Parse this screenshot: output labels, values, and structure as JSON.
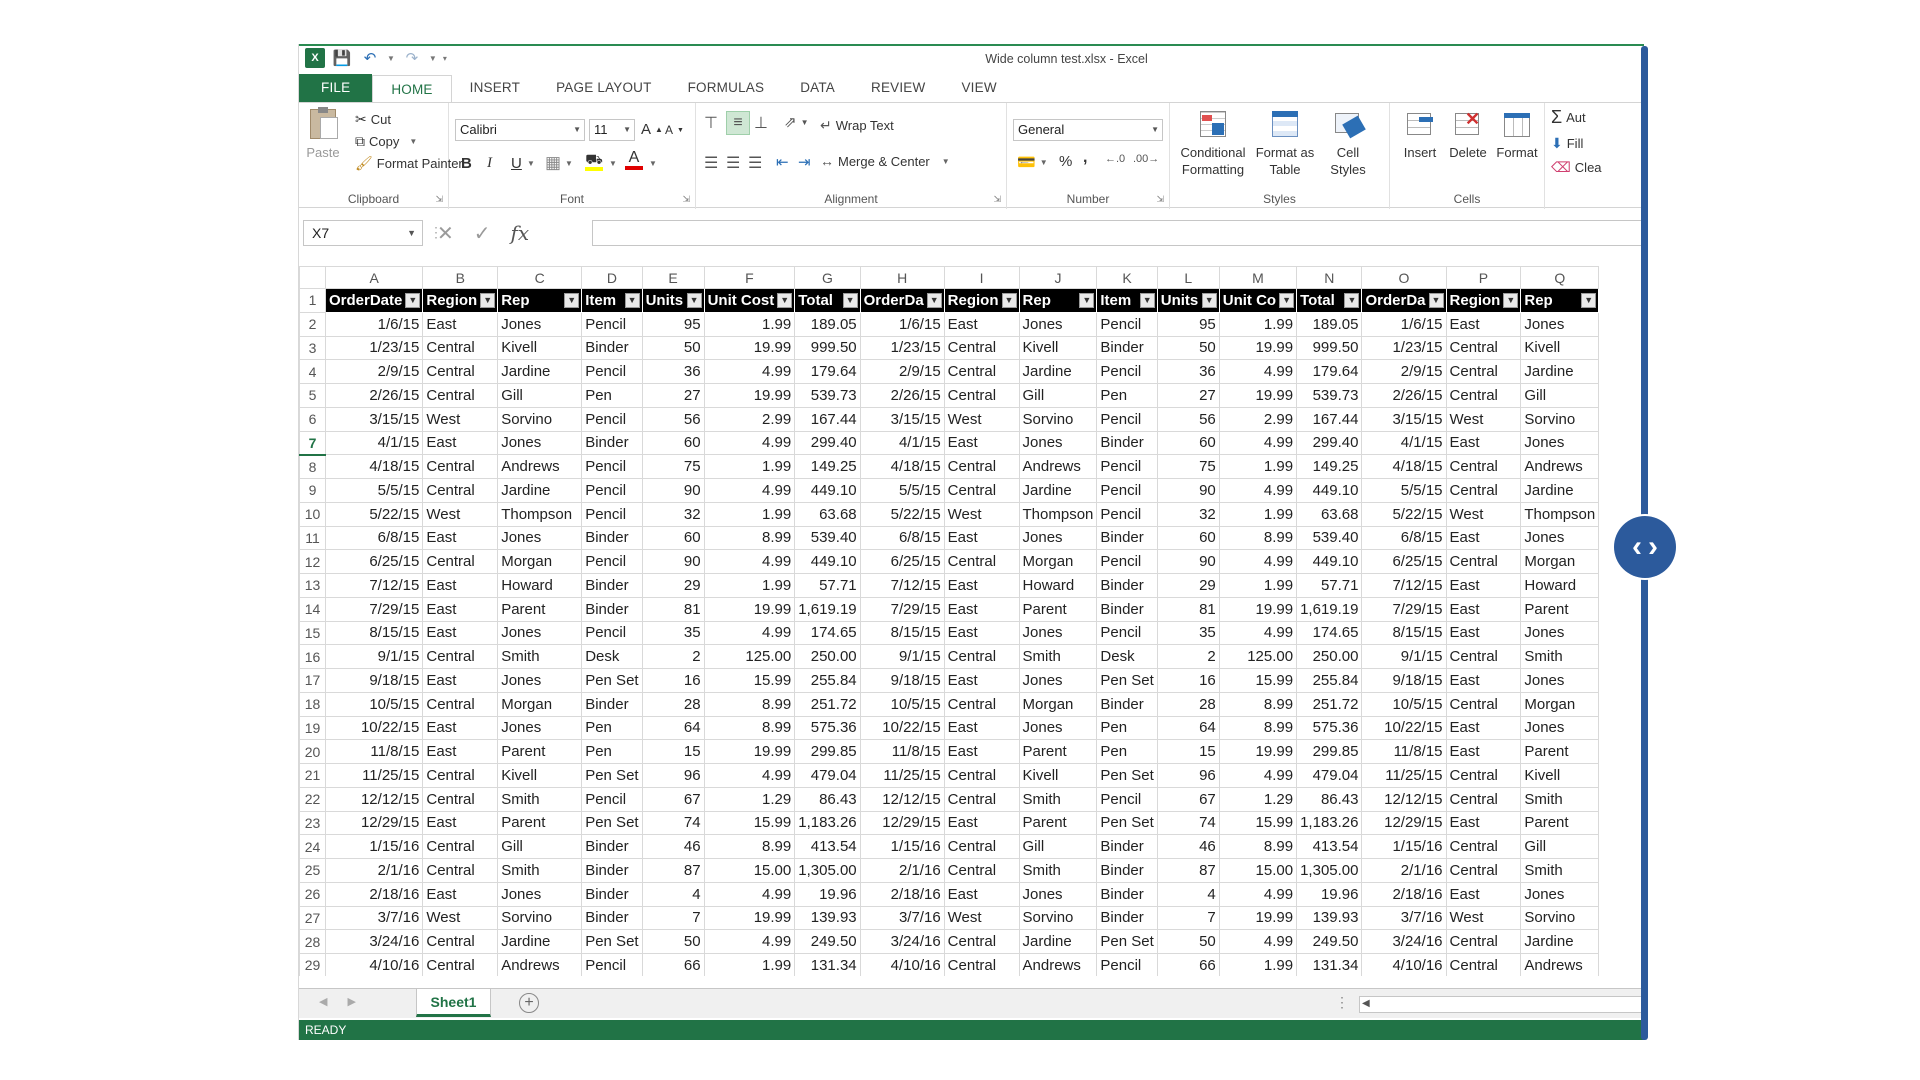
{
  "window": {
    "title": "Wide column test.xlsx - Excel"
  },
  "ribbon_tabs": [
    {
      "label": "FILE"
    },
    {
      "label": "HOME"
    },
    {
      "label": "INSERT"
    },
    {
      "label": "PAGE LAYOUT"
    },
    {
      "label": "FORMULAS"
    },
    {
      "label": "DATA"
    },
    {
      "label": "REVIEW"
    },
    {
      "label": "VIEW"
    }
  ],
  "clipboard": {
    "paste": "Paste",
    "cut": "Cut",
    "copy": "Copy",
    "format_painter": "Format Painter",
    "label": "Clipboard"
  },
  "font": {
    "name": "Calibri",
    "size": "11",
    "bold": "B",
    "italic": "I",
    "underline": "U",
    "label": "Font"
  },
  "alignment": {
    "wrap_text": "Wrap Text",
    "merge_center": "Merge & Center",
    "label": "Alignment"
  },
  "number": {
    "format": "General",
    "percent": "%",
    "comma": ",",
    "label": "Number"
  },
  "styles": {
    "conditional_1": "Conditional",
    "conditional_2": "Formatting",
    "format_table_1": "Format as",
    "format_table_2": "Table",
    "cell_styles_1": "Cell",
    "cell_styles_2": "Styles",
    "label": "Styles"
  },
  "cells": {
    "insert": "Insert",
    "delete": "Delete",
    "format": "Format",
    "label": "Cells"
  },
  "editing": {
    "autosum": "Aut",
    "fill": "Fill",
    "clear": "Clea"
  },
  "formula_bar": {
    "name_box": "X7",
    "fx": "fx",
    "value": ""
  },
  "grid": {
    "columns": [
      "A",
      "B",
      "C",
      "D",
      "E",
      "F",
      "G",
      "H",
      "I",
      "J",
      "K",
      "L",
      "M",
      "N",
      "O",
      "P",
      "Q"
    ],
    "selected_row": 7,
    "header_labels": [
      "OrderDate",
      "Region",
      "Rep",
      "Item",
      "Units",
      "Unit Cost",
      "Total",
      "OrderDa",
      "Region",
      "Rep",
      "Item",
      "Units",
      "Unit Co",
      "Total",
      "OrderDa",
      "Region",
      "Rep"
    ],
    "rows": [
      [
        "1/6/15",
        "East",
        "Jones",
        "Pencil",
        "95",
        "1.99",
        "189.05"
      ],
      [
        "1/23/15",
        "Central",
        "Kivell",
        "Binder",
        "50",
        "19.99",
        "999.50"
      ],
      [
        "2/9/15",
        "Central",
        "Jardine",
        "Pencil",
        "36",
        "4.99",
        "179.64"
      ],
      [
        "2/26/15",
        "Central",
        "Gill",
        "Pen",
        "27",
        "19.99",
        "539.73"
      ],
      [
        "3/15/15",
        "West",
        "Sorvino",
        "Pencil",
        "56",
        "2.99",
        "167.44"
      ],
      [
        "4/1/15",
        "East",
        "Jones",
        "Binder",
        "60",
        "4.99",
        "299.40"
      ],
      [
        "4/18/15",
        "Central",
        "Andrews",
        "Pencil",
        "75",
        "1.99",
        "149.25"
      ],
      [
        "5/5/15",
        "Central",
        "Jardine",
        "Pencil",
        "90",
        "4.99",
        "449.10"
      ],
      [
        "5/22/15",
        "West",
        "Thompson",
        "Pencil",
        "32",
        "1.99",
        "63.68"
      ],
      [
        "6/8/15",
        "East",
        "Jones",
        "Binder",
        "60",
        "8.99",
        "539.40"
      ],
      [
        "6/25/15",
        "Central",
        "Morgan",
        "Pencil",
        "90",
        "4.99",
        "449.10"
      ],
      [
        "7/12/15",
        "East",
        "Howard",
        "Binder",
        "29",
        "1.99",
        "57.71"
      ],
      [
        "7/29/15",
        "East",
        "Parent",
        "Binder",
        "81",
        "19.99",
        "1,619.19"
      ],
      [
        "8/15/15",
        "East",
        "Jones",
        "Pencil",
        "35",
        "4.99",
        "174.65"
      ],
      [
        "9/1/15",
        "Central",
        "Smith",
        "Desk",
        "2",
        "125.00",
        "250.00"
      ],
      [
        "9/18/15",
        "East",
        "Jones",
        "Pen Set",
        "16",
        "15.99",
        "255.84"
      ],
      [
        "10/5/15",
        "Central",
        "Morgan",
        "Binder",
        "28",
        "8.99",
        "251.72"
      ],
      [
        "10/22/15",
        "East",
        "Jones",
        "Pen",
        "64",
        "8.99",
        "575.36"
      ],
      [
        "11/8/15",
        "East",
        "Parent",
        "Pen",
        "15",
        "19.99",
        "299.85"
      ],
      [
        "11/25/15",
        "Central",
        "Kivell",
        "Pen Set",
        "96",
        "4.99",
        "479.04"
      ],
      [
        "12/12/15",
        "Central",
        "Smith",
        "Pencil",
        "67",
        "1.29",
        "86.43"
      ],
      [
        "12/29/15",
        "East",
        "Parent",
        "Pen Set",
        "74",
        "15.99",
        "1,183.26"
      ],
      [
        "1/15/16",
        "Central",
        "Gill",
        "Binder",
        "46",
        "8.99",
        "413.54"
      ],
      [
        "2/1/16",
        "Central",
        "Smith",
        "Binder",
        "87",
        "15.00",
        "1,305.00"
      ],
      [
        "2/18/16",
        "East",
        "Jones",
        "Binder",
        "4",
        "4.99",
        "19.96"
      ],
      [
        "3/7/16",
        "West",
        "Sorvino",
        "Binder",
        "7",
        "19.99",
        "139.93"
      ],
      [
        "3/24/16",
        "Central",
        "Jardine",
        "Pen Set",
        "50",
        "4.99",
        "249.50"
      ],
      [
        "4/10/16",
        "Central",
        "Andrews",
        "Pencil",
        "66",
        "1.99",
        "131.34"
      ]
    ]
  },
  "sheet_tabs": [
    {
      "label": "Sheet1"
    }
  ],
  "status": {
    "text": "READY"
  }
}
